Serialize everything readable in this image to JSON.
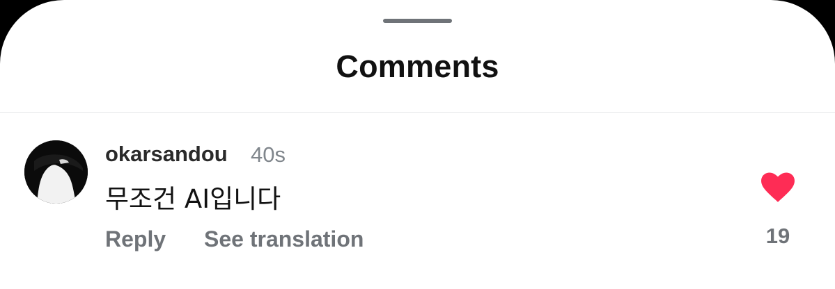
{
  "sheet": {
    "title": "Comments"
  },
  "comment": {
    "username": "okarsandou",
    "timestamp": "40s",
    "text": "무조건 AI입니다",
    "reply_label": "Reply",
    "translate_label": "See translation",
    "like_count": "19",
    "liked": true,
    "avatar_icon": "profile-photo"
  },
  "colors": {
    "heart": "#fe2c55",
    "secondary_text": "#6f7378",
    "background": "#ffffff"
  }
}
